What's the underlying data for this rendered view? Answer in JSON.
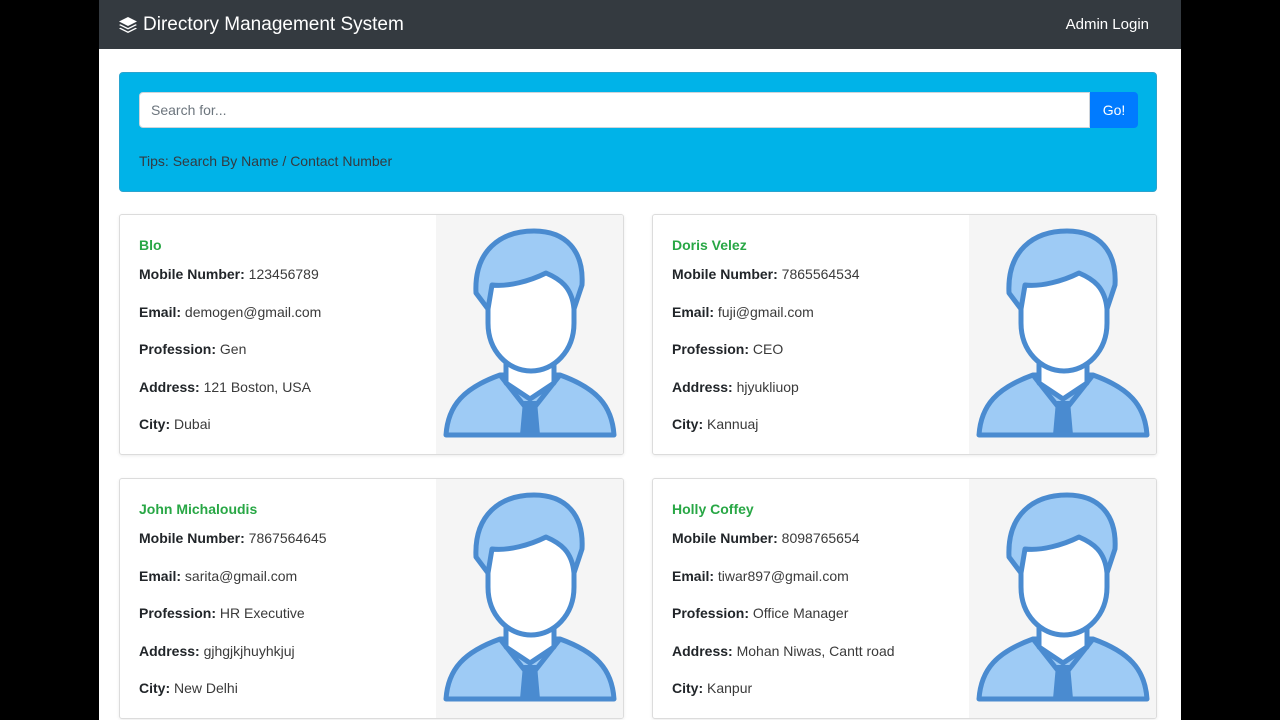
{
  "navbar": {
    "brand_icon": "layers-icon",
    "brand": "Directory Management System",
    "login": "Admin Login"
  },
  "search": {
    "placeholder": "Search for...",
    "button": "Go!",
    "tips": "Tips: Search By Name / Contact Number"
  },
  "labels": {
    "mobile": "Mobile Number:",
    "email": "Email:",
    "profession": "Profession:",
    "address": "Address:",
    "city": "City:"
  },
  "colors": {
    "navbar": "#343a40",
    "search_panel": "#00b3e8",
    "go_button": "#007bff",
    "name": "#28a745",
    "avatar": "#4a8bd0"
  },
  "contacts": [
    {
      "name": "Blo",
      "mobile": "123456789",
      "email": "demogen@gmail.com",
      "profession": "Gen",
      "address": "121 Boston, USA",
      "city": "Dubai",
      "avatar": "user-avatar-icon"
    },
    {
      "name": "Doris Velez",
      "mobile": "7865564534",
      "email": "fuji@gmail.com",
      "profession": "CEO",
      "address": "hjyukliuop",
      "city": "Kannuaj",
      "avatar": "user-avatar-icon"
    },
    {
      "name": "John Michaloudis",
      "mobile": "7867564645",
      "email": "sarita@gmail.com",
      "profession": "HR Executive",
      "address": "gjhgjkjhuyhkjuj",
      "city": "New Delhi",
      "avatar": "user-avatar-icon"
    },
    {
      "name": "Holly Coffey",
      "mobile": "8098765654",
      "email": "tiwar897@gmail.com",
      "profession": "Office Manager",
      "address": "Mohan Niwas, Cantt road",
      "city": "Kanpur",
      "avatar": "user-avatar-icon"
    }
  ]
}
